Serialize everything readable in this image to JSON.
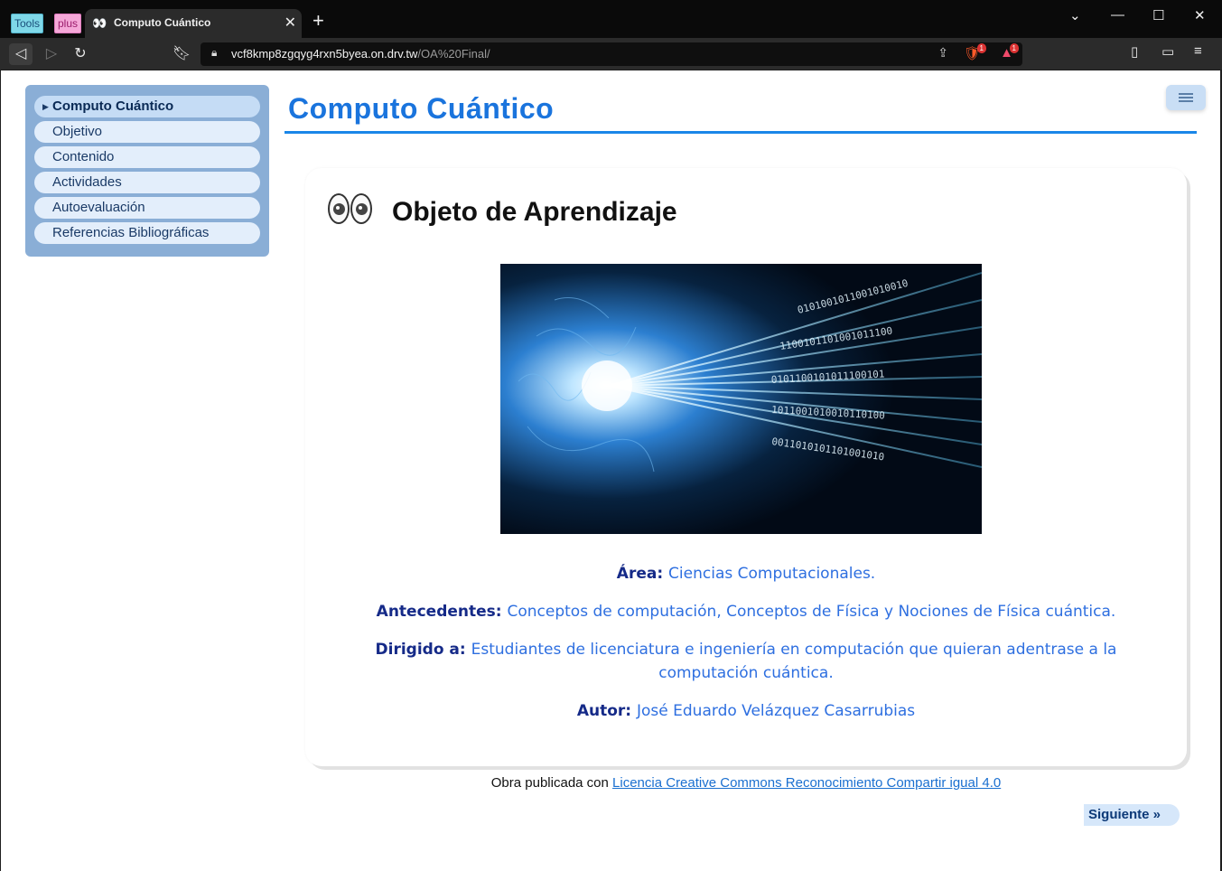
{
  "browser": {
    "extensions": [
      "Tools",
      "plus"
    ],
    "tab_title": "Computo Cuántico",
    "url_host": "vcf8kmp8zgqyg4rxn5byea.on.drv.tw",
    "url_path": "/OA%20Final/",
    "brave_badge": "1",
    "rewards_badge": "1"
  },
  "sidebar": {
    "items": [
      {
        "label": "Computo Cuántico",
        "active": true
      },
      {
        "label": "Objetivo"
      },
      {
        "label": "Contenido"
      },
      {
        "label": "Actividades"
      },
      {
        "label": "Autoevaluación"
      },
      {
        "label": "Referencias Bibliográficas"
      }
    ]
  },
  "page": {
    "site_title": "Computo Cuántico",
    "heading": "Objeto de Aprendizaje",
    "meta": [
      {
        "key": "Área",
        "value": "Ciencias Computacionales."
      },
      {
        "key": "Antecedentes",
        "value": "Conceptos de computación, Conceptos de Física y Nociones de Física cuántica."
      },
      {
        "key": "Dirigido a",
        "value": "Estudiantes de licenciatura e ingeniería en computación que quieran adentrase a la computación cuántica."
      },
      {
        "key": "Autor",
        "value": "José Eduardo Velázquez Casarrubias"
      }
    ],
    "footer_prefix": "Obra publicada con ",
    "footer_link": "Licencia Creative Commons Reconocimiento Compartir igual 4.0",
    "next_label": "Siguiente »"
  },
  "icons": {
    "eyes": "eyes-emoji-icon",
    "menu": "hamburger-menu-icon"
  },
  "colors": {
    "title": "#1a74dd",
    "sidebar_bg": "#8aaed6",
    "meta_key": "#152a88",
    "meta_value": "#2e6fe0"
  }
}
